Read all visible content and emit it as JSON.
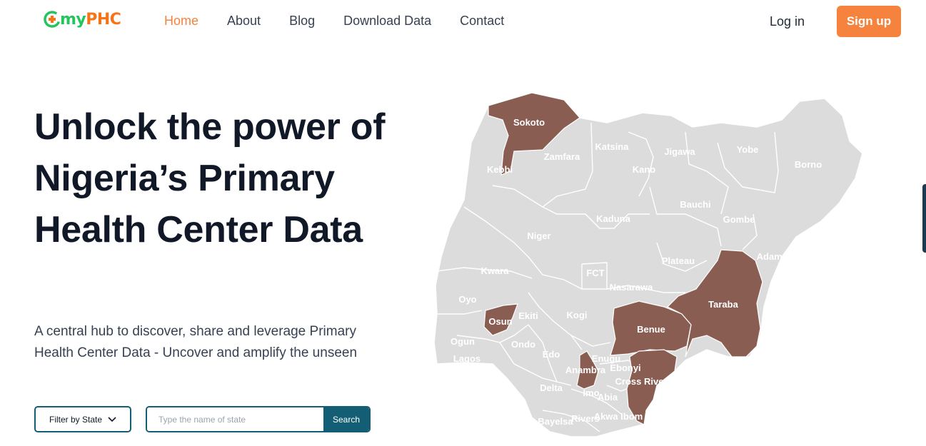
{
  "brand": {
    "name_my": "my",
    "name_phc": "PHC",
    "accent": "#f5823d",
    "green": "#22c55e"
  },
  "nav": {
    "items": [
      {
        "label": "Home",
        "active": true
      },
      {
        "label": "About",
        "active": false
      },
      {
        "label": "Blog",
        "active": false
      },
      {
        "label": "Download Data",
        "active": false
      },
      {
        "label": "Contact",
        "active": false
      }
    ],
    "login_label": "Log in",
    "signup_label": "Sign up"
  },
  "hero": {
    "title": "Unlock the power of Nigeria’s Primary Health Center Data",
    "subtitle": "A central hub to discover, share and leverage Primary Health Center Data - Uncover and amplify the unseen"
  },
  "search": {
    "filter_label": "Filter by State",
    "placeholder": "Type the name of state",
    "button_label": "Search",
    "button_color": "#135e75"
  },
  "map": {
    "base_color": "#dcdcdc",
    "highlight_color": "#8a5d52",
    "highlighted_states": [
      "Sokoto",
      "Osun",
      "Anambra",
      "Benue",
      "Taraba",
      "Cross River"
    ],
    "labels": [
      "Sokoto",
      "Zamfara",
      "Katsina",
      "Jigawa",
      "Yobe",
      "Borno",
      "Kebbi",
      "Kano",
      "Bauchi",
      "Gombe",
      "Kaduna",
      "Niger",
      "Plateau",
      "Adamawa",
      "FCT",
      "Kwara",
      "Nasarawa",
      "Taraba",
      "Oyo",
      "Osun",
      "Ekiti",
      "Kogi",
      "Benue",
      "Ogun",
      "Ondo",
      "Edo",
      "Enugu",
      "Ebonyi",
      "Anambra",
      "Cross River",
      "Delta",
      "Imo",
      "Abia",
      "Lagos",
      "Rivers",
      "Akwa Ibom",
      "Bayelsa"
    ]
  }
}
